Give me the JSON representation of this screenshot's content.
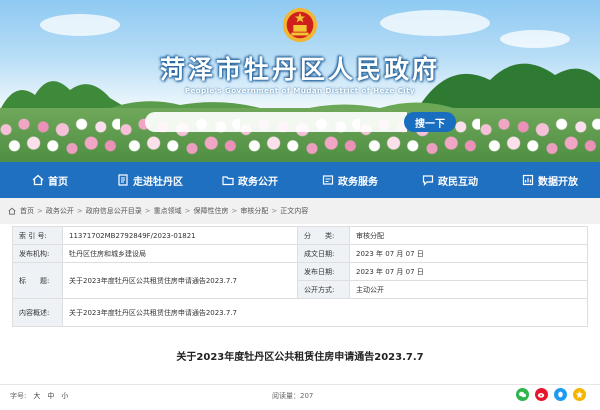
{
  "site": {
    "title": "菏泽市牡丹区人民政府",
    "subtitle": "People's Government of Mudan District of Heze City"
  },
  "search": {
    "placeholder": "",
    "button_label": "搜一下"
  },
  "nav": {
    "items": [
      {
        "label": "首页",
        "icon": "home-icon"
      },
      {
        "label": "走进牡丹区",
        "icon": "document-icon"
      },
      {
        "label": "政务公开",
        "icon": "folder-icon"
      },
      {
        "label": "政务服务",
        "icon": "service-icon"
      },
      {
        "label": "政民互动",
        "icon": "chat-icon"
      },
      {
        "label": "数据开放",
        "icon": "chart-icon"
      }
    ]
  },
  "breadcrumb": {
    "icon": "home-icon",
    "items": [
      "首页",
      "政务公开",
      "政府信息公开目录",
      "重点领域",
      "保障性住房",
      "审核分配",
      "正文内容"
    ]
  },
  "info": {
    "index_label": "索 引 号:",
    "index_value": "11371702MB2792849F/2023-01821",
    "category_label": "分　　类:",
    "category_value": "审核分配",
    "publisher_label": "发布机构:",
    "publisher_value": "牡丹区住房和城乡建设局",
    "created_label": "成文日期:",
    "created_value": "2023 年 07 月 07 日",
    "title_label": "标　　题:",
    "title_value": "关于2023年度牡丹区公共租赁住房申请通告2023.7.7",
    "published_label": "发布日期:",
    "published_value": "2023 年 07 月 07 日",
    "disclosure_label": "公开方式:",
    "disclosure_value": "主动公开",
    "summary_label": "内容概述:",
    "summary_value": "关于2023年度牡丹区公共租赁住房申请通告2023.7.7"
  },
  "article": {
    "title": "关于2023年度牡丹区公共租赁住房申请通告2023.7.7"
  },
  "footer": {
    "fontsize_label": "字号:",
    "sizes": [
      "大",
      "中",
      "小"
    ],
    "views_label": "阅读量：207",
    "share_icons": [
      "wechat-icon",
      "weibo-icon",
      "qq-icon",
      "qzone-icon"
    ]
  },
  "colors": {
    "nav_bg": "#1f70c1",
    "search_button": "#1a6ec0",
    "label_cell_bg": "#eef2f6"
  }
}
